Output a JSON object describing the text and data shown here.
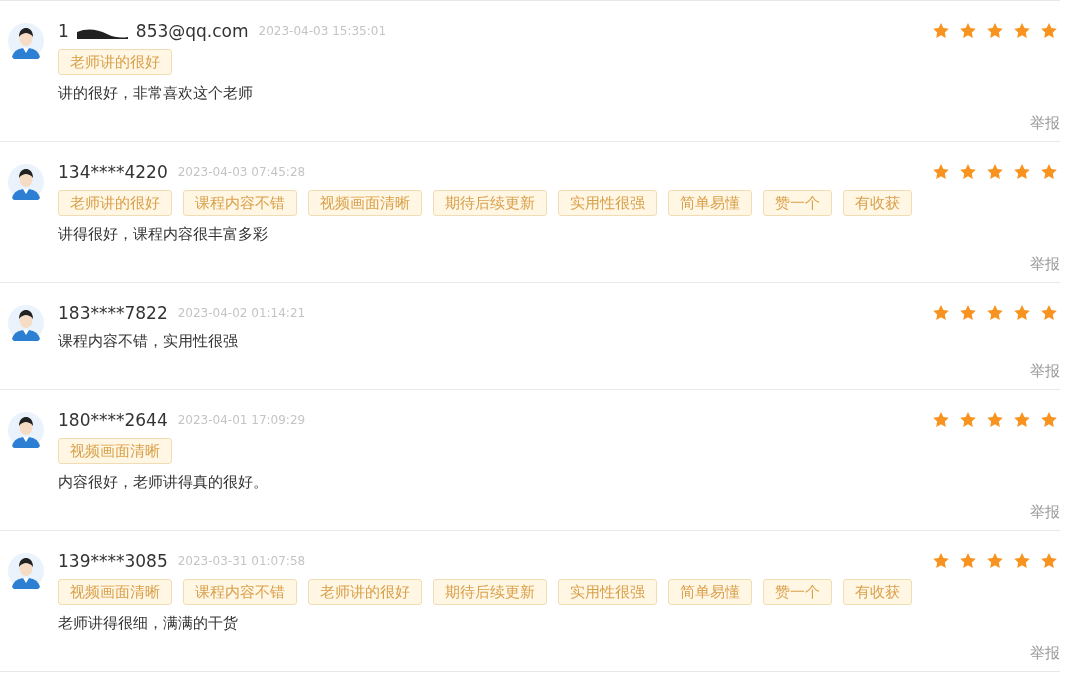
{
  "reviews": [
    {
      "user_parts": [
        "1",
        "853@qq.com"
      ],
      "time": "2023-04-03 15:35:01",
      "stars": 5,
      "tags": [
        "老师讲的很好"
      ],
      "comment": "讲的很好，非常喜欢这个老师",
      "report": "举报"
    },
    {
      "user_parts": [
        "134****4220"
      ],
      "time": "2023-04-03 07:45:28",
      "stars": 5,
      "tags": [
        "老师讲的很好",
        "课程内容不错",
        "视频画面清晰",
        "期待后续更新",
        "实用性很强",
        "简单易懂",
        "赞一个",
        "有收获"
      ],
      "comment": "讲得很好，课程内容很丰富多彩",
      "report": "举报"
    },
    {
      "user_parts": [
        "183****7822"
      ],
      "time": "2023-04-02 01:14:21",
      "stars": 5,
      "comment": "课程内容不错，实用性很强",
      "report": "举报"
    },
    {
      "user_parts": [
        "180****2644"
      ],
      "time": "2023-04-01 17:09:29",
      "stars": 5,
      "tags": [
        "视频画面清晰"
      ],
      "comment": "内容很好，老师讲得真的很好。",
      "report": "举报"
    },
    {
      "user_parts": [
        "139****3085"
      ],
      "time": "2023-03-31 01:07:58",
      "stars": 5,
      "tags": [
        "视频画面清晰",
        "课程内容不错",
        "老师讲的很好",
        "期待后续更新",
        "实用性很强",
        "简单易懂",
        "赞一个",
        "有收获"
      ],
      "comment": "老师讲得很细，满满的干货",
      "report": "举报"
    }
  ]
}
